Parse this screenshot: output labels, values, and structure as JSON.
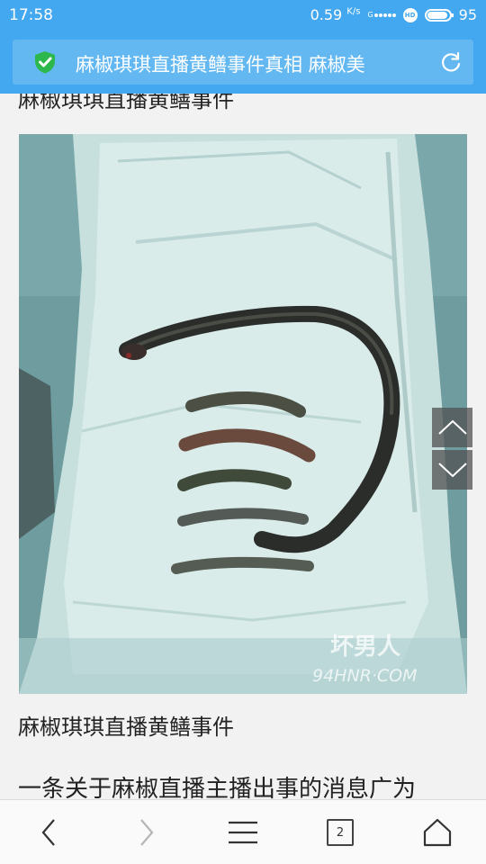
{
  "status_bar": {
    "time": "17:58",
    "net_speed": "0.59",
    "net_unit": "K/s",
    "signal_label": "G",
    "hd_label": "HD",
    "battery_level": "95"
  },
  "title_bar": {
    "title": "麻椒琪琪直播黄鳝事件真相 麻椒美",
    "secure_icon": "shield-check-icon",
    "refresh_icon": "refresh-icon"
  },
  "article": {
    "clipped_heading": "麻椒琪琪直播黄鳝事件",
    "image_caption": "麻椒琪琪直播黄鳝事件",
    "paragraph_start": "一条关于麻椒直播主播出事的消息广为",
    "watermark_logo": "坏男人",
    "watermark_url": "94HNR·COM"
  },
  "bottom_bar": {
    "tab_count": "2",
    "icons": [
      "back-icon",
      "forward-icon",
      "menu-icon",
      "tabs-icon",
      "home-icon"
    ]
  },
  "colors": {
    "accent": "#43a8ef",
    "secure_green": "#2db84d"
  }
}
